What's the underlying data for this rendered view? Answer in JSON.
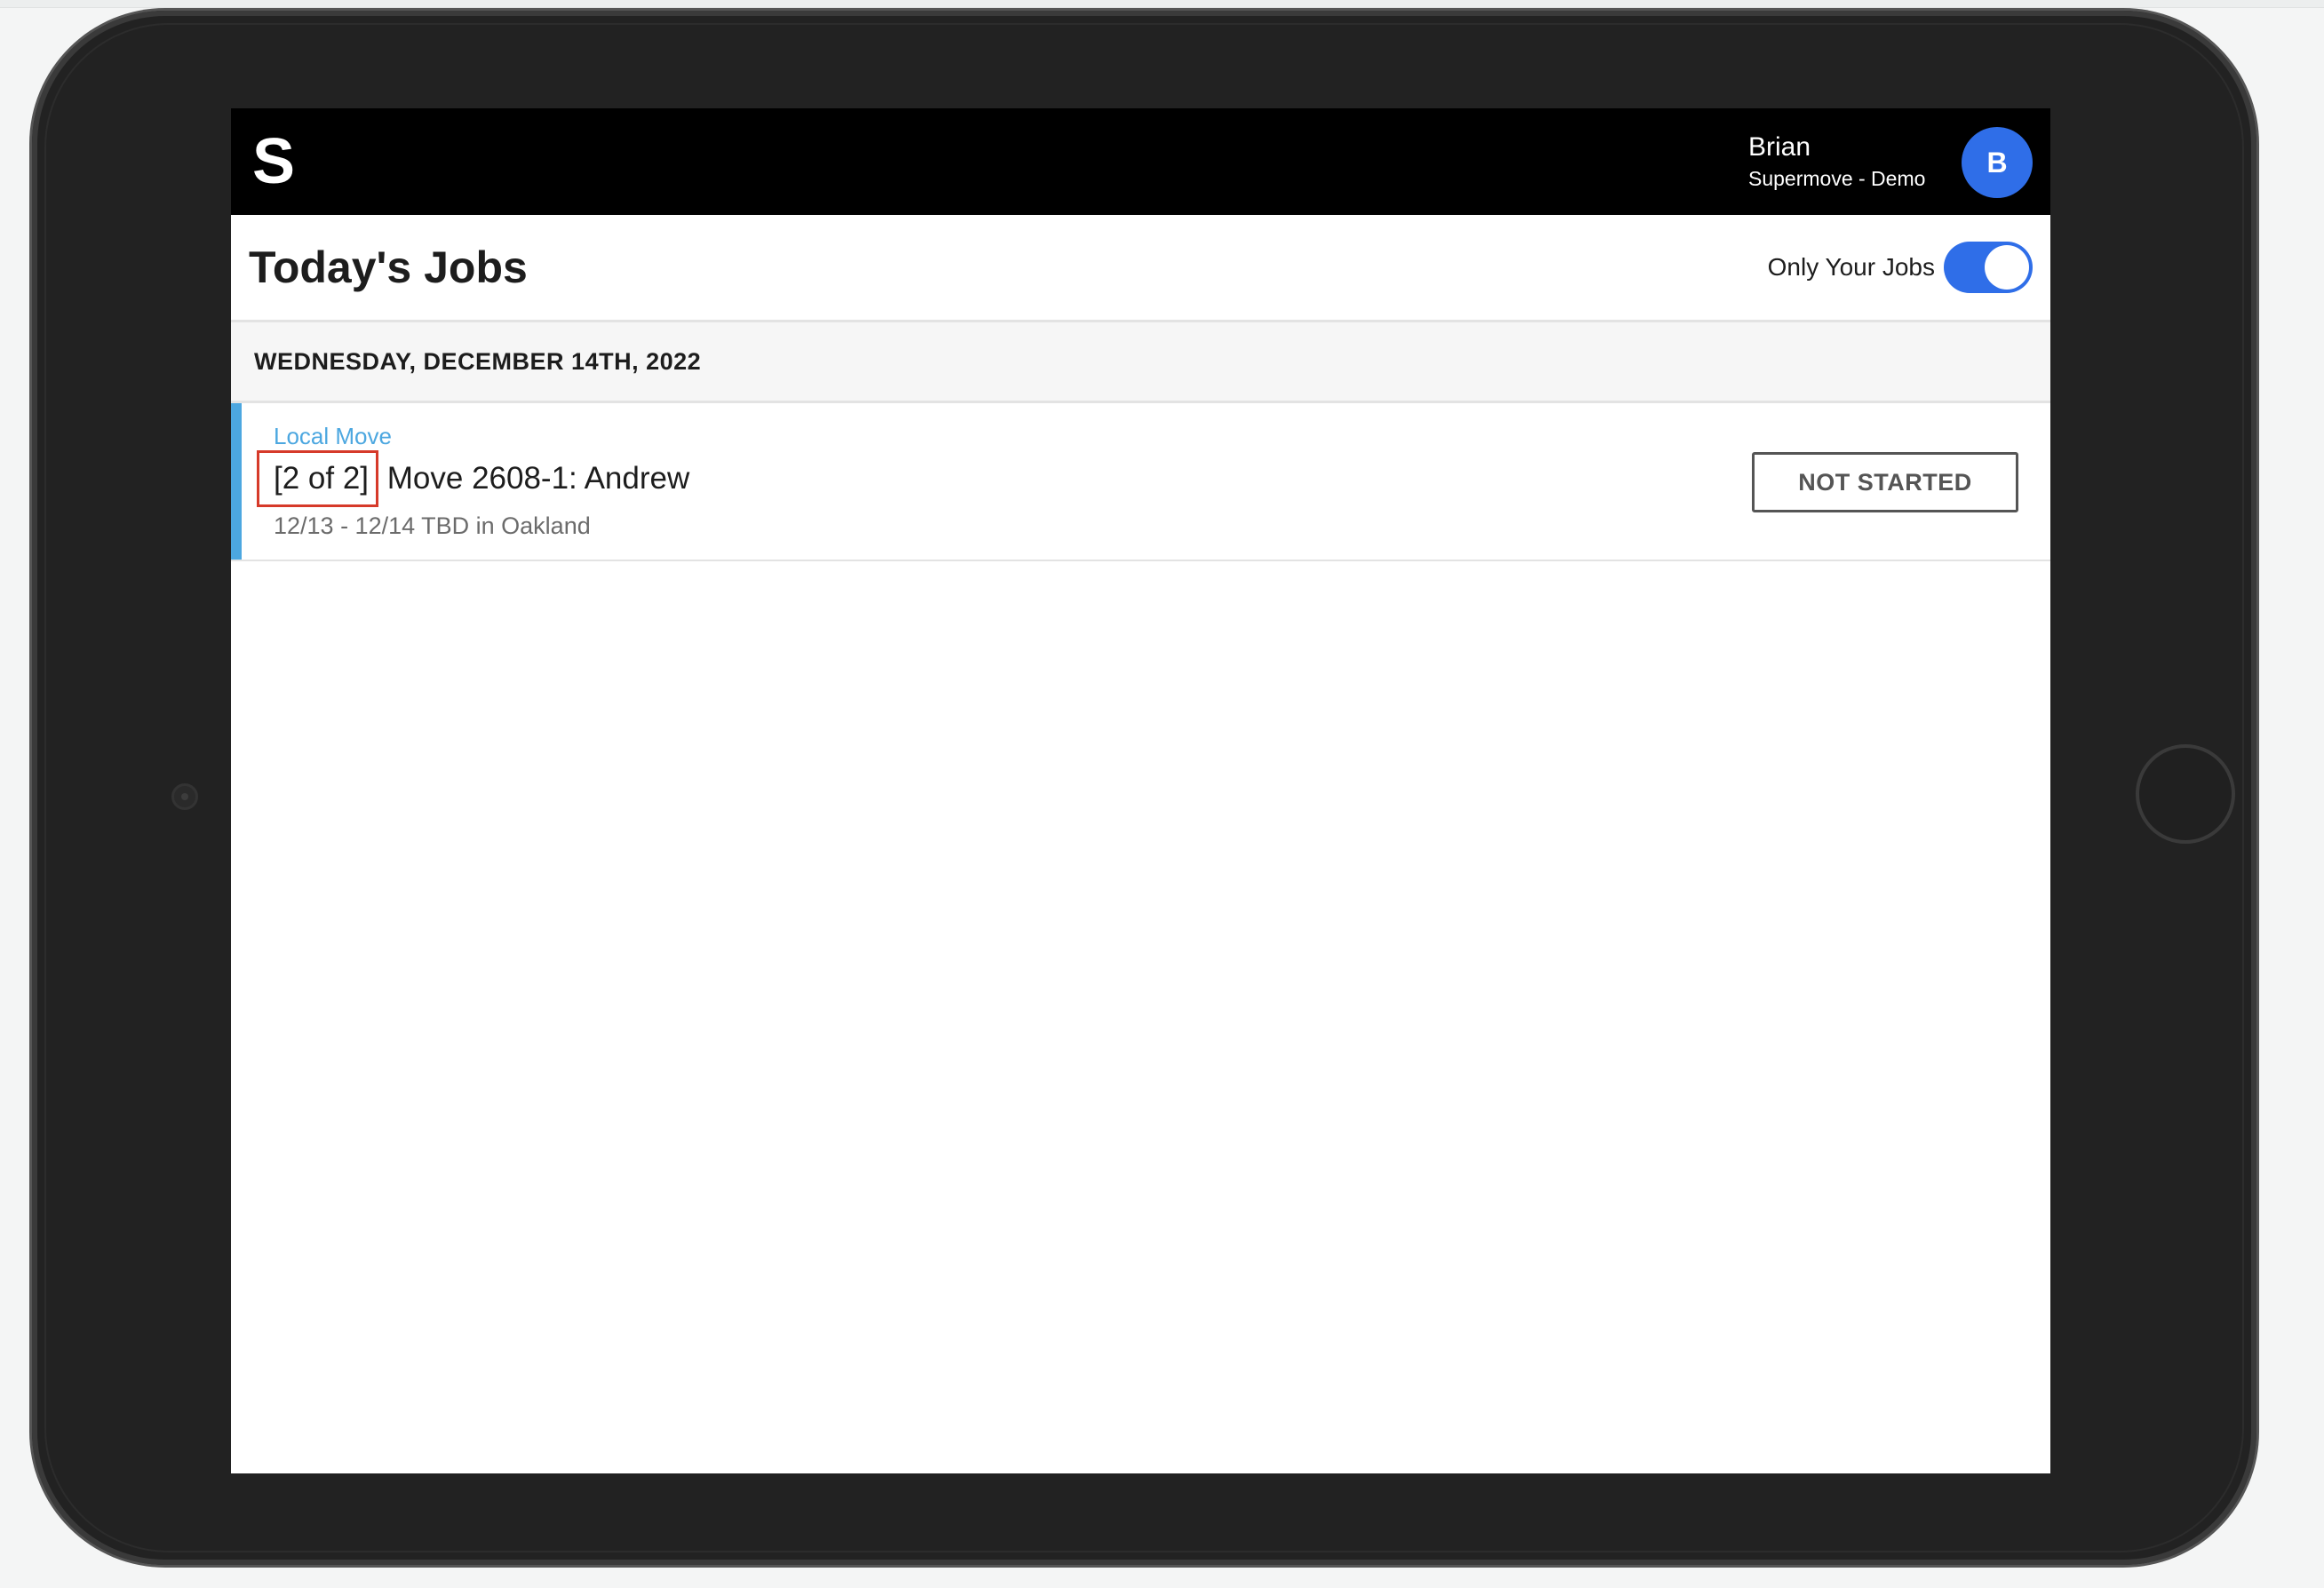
{
  "header": {
    "logo_text": "S",
    "user_name": "Brian",
    "organization": "Supermove - Demo",
    "avatar_initial": "B"
  },
  "page": {
    "title": "Today's Jobs",
    "toggle_label": "Only Your Jobs",
    "toggle_on": true
  },
  "date_section": {
    "label": "WEDNESDAY, DECEMBER 14TH, 2022"
  },
  "jobs": [
    {
      "type": "Local Move",
      "sequence": "[2 of 2]",
      "title": "Move 2608-1: Andrew",
      "dates": "12/13 - 12/14 TBD in Oakland",
      "status": "NOT STARTED"
    }
  ],
  "colors": {
    "accent_blue": "#2f6ee8",
    "job_type_blue": "#4ca7e0",
    "highlight_red": "#d63a2a"
  }
}
